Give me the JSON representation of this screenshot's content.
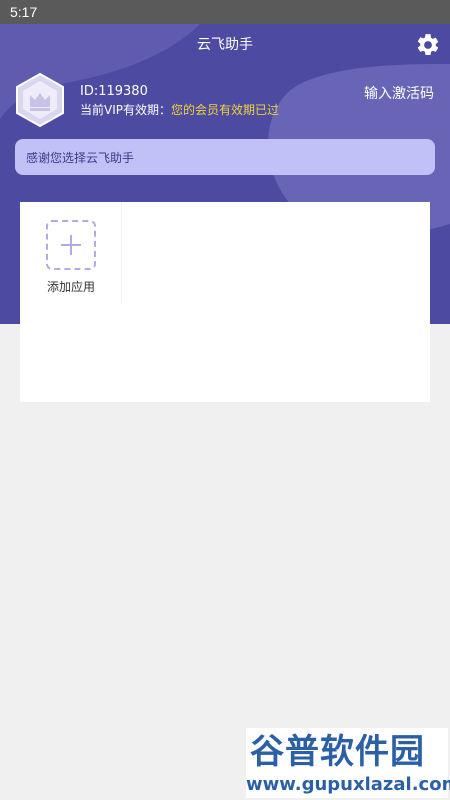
{
  "status_bar": {
    "time": "5:17"
  },
  "header": {
    "title": "云飞助手",
    "settings_icon": "gear-icon"
  },
  "user": {
    "avatar_icon": "crown-hexagon-icon",
    "id": "ID:119380",
    "vip_label": "当前VIP有效期：",
    "vip_status": "您的会员有效期已过",
    "activate_label": "输入激活码"
  },
  "notice": {
    "text": "感谢您选择云飞助手"
  },
  "apps": {
    "add_label": "添加应用",
    "add_icon": "plus-icon"
  },
  "watermark": {
    "main": "谷普软件园",
    "url": "www.gupuxlazal.com"
  },
  "colors": {
    "header_bg": "#4d4aa2",
    "header_shape": "#6865b6",
    "vip_status": "#f2d43a",
    "notice_bg": "#c1c1f7",
    "add_border": "#b3a9e6"
  }
}
